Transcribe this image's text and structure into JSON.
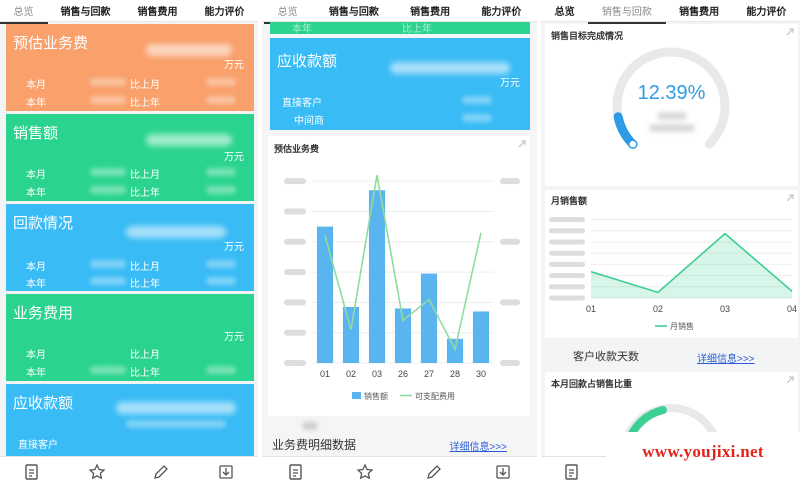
{
  "tabs": [
    "总览",
    "销售与回款",
    "销售费用",
    "能力评价"
  ],
  "panel1": {
    "cards": [
      {
        "title": "预估业务费",
        "unit": "万元",
        "rows": [
          {
            "label": "本月",
            "compare": "比上月"
          },
          {
            "label": "本年",
            "compare": "比上年"
          }
        ]
      },
      {
        "title": "销售额",
        "unit": "万元",
        "rows": [
          {
            "label": "本月",
            "compare": "比上月"
          },
          {
            "label": "本年",
            "compare": "比上年"
          }
        ]
      },
      {
        "title": "回款情况",
        "unit": "万元",
        "rows": [
          {
            "label": "本月",
            "compare": "比上月"
          },
          {
            "label": "本年",
            "compare": "比上年"
          }
        ]
      },
      {
        "title": "业务费用",
        "unit": "万元",
        "rows": [
          {
            "label": "本月",
            "compare": "比上月"
          },
          {
            "label": "本年",
            "compare": "比上年"
          }
        ]
      },
      {
        "title": "应收款额",
        "unit": "",
        "rows": [
          {
            "label": "直接客户",
            "compare": ""
          }
        ]
      }
    ],
    "colors": [
      "#f9a06b",
      "#2bd48e",
      "#39bbf5",
      "#2bd48e",
      "#39bbf5"
    ]
  },
  "panel2": {
    "top_card_partial": "本年",
    "top_card_compare": "比上年",
    "receivable": {
      "title": "应收款额",
      "unit": "万元",
      "rows": [
        "直接客户",
        "中间商"
      ]
    },
    "chart_title": "预估业务费",
    "footer_label": "业务费明细数据",
    "detail_link": "详细信息>>>"
  },
  "panel3": {
    "gauge_title": "销售目标完成情况",
    "gauge_value": "12.39%",
    "gauge_fraction": 0.1239,
    "monthly_title": "月销售额",
    "customer_days": "客户收款天数",
    "detail_link": "详细信息>>>",
    "ratio_title": "本月回款占销售比重"
  },
  "watermark": "www.youjixi.net",
  "chart_data": [
    {
      "type": "bar",
      "categories": [
        "01",
        "02",
        "03",
        "26",
        "27",
        "28",
        "30"
      ],
      "series": [
        {
          "name": "销售额",
          "type": "bar",
          "values": [
            4500,
            1850,
            5700,
            1800,
            2950,
            800,
            1700
          ],
          "color": "#5ab4ef"
        },
        {
          "name": "可支配费用",
          "type": "line",
          "values": [
            4200,
            1100,
            6200,
            1400,
            2100,
            450,
            4300
          ],
          "color": "#8fdc9f"
        }
      ],
      "ylim": [
        0,
        6500
      ],
      "y2lim": [
        0,
        10000
      ],
      "legend": "bottom",
      "grid": true
    },
    {
      "type": "area",
      "categories": [
        "01",
        "02",
        "03",
        "04"
      ],
      "series": [
        {
          "name": "月销售",
          "values": [
            470000,
            100000,
            1150000,
            120000
          ],
          "color": "#3dcf93"
        }
      ],
      "ylim": [
        0,
        1500000
      ],
      "legend": "bottom",
      "grid": true
    }
  ]
}
